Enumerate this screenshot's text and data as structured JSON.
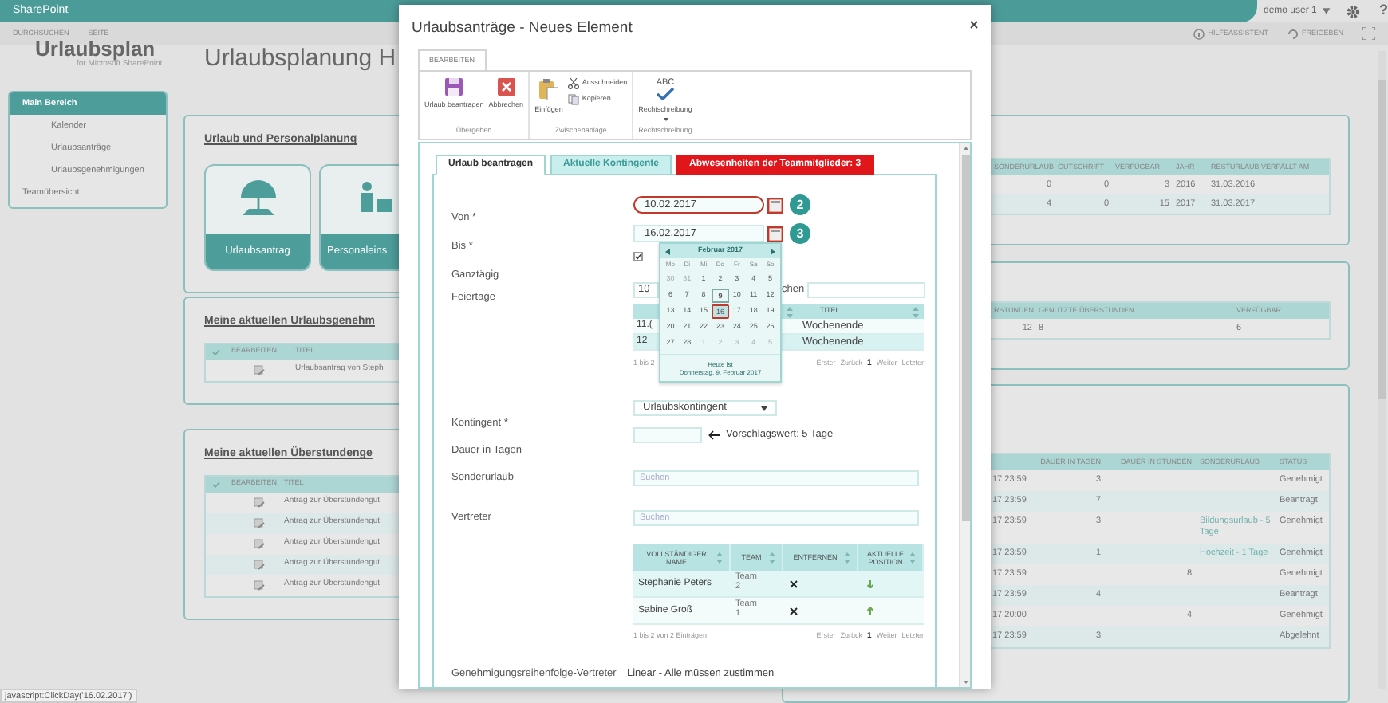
{
  "top_bar": {
    "brand": "SharePoint",
    "user": "demo user 1",
    "help": "?"
  },
  "command_bar": {
    "left": [
      "DURCHSUCHEN",
      "SEITE"
    ],
    "right": [
      "HILFEASSISTENT",
      "FREIGEBEN"
    ]
  },
  "logo": {
    "name": "Urlaubsplan",
    "subtitle": "for Microsoft SharePoint"
  },
  "page_title": "Urlaubsplanung H",
  "nav": [
    {
      "label": "Main Bereich",
      "selected": true,
      "children": [
        {
          "label": "Kalender",
          "selected": false
        },
        {
          "label": "Urlaubsanträge",
          "selected": false
        },
        {
          "label": "Urlaubsgenehmigungen",
          "selected": false
        }
      ]
    },
    {
      "label": "Teamübersicht",
      "selected": false
    }
  ],
  "cards_left": [
    {
      "kind": "tiles",
      "title": "Urlaub und Personalplanung",
      "tiles": [
        "Urlaubsantrag",
        "Personaleins"
      ]
    },
    {
      "kind": "list",
      "title": "Meine aktuellen Urlaubsgenehm",
      "columns": [
        "BEARBEITEN",
        "TITEL"
      ],
      "rows": [
        "Urlaubsantrag von Steph"
      ]
    },
    {
      "kind": "list",
      "title": "Meine aktuellen Überstundenge",
      "columns": [
        "BEARBEITEN",
        "TITEL"
      ],
      "rows": [
        "Antrag zur Überstundengut",
        "Antrag zur Überstundengut",
        "Antrag zur Überstundengut",
        "Antrag zur Überstundengut",
        "Antrag zur Überstundengut"
      ]
    }
  ],
  "contingent_table": {
    "columns": [
      "SONDERURLAUB",
      "GUTSCHRIFT",
      "VERFÜGBAR",
      "JAHR",
      "RESTURLAUB VERFÄLLT AM"
    ],
    "rows": [
      [
        "0",
        "0",
        "3",
        "2016",
        "31.03.2016"
      ],
      [
        "4",
        "0",
        "15",
        "2017",
        "31.03.2017"
      ]
    ]
  },
  "overtime_table": {
    "columns": [
      "RSTUNDEN",
      "GENUTZTE ÜBERSTUNDEN",
      "VERFÜGBAR"
    ],
    "rows": [
      [
        "12",
        "8",
        "6"
      ]
    ]
  },
  "requests_table": {
    "columns": [
      "DAUER IN TAGEN",
      "DAUER IN STUNDEN",
      "SONDERURLAUB",
      "STATUS"
    ],
    "rows": [
      {
        "column_1": "17 23:59",
        "days": "3",
        "status": "Genehmigt"
      },
      {
        "column_1": "17 23:59",
        "days": "7",
        "status": "Beantragt"
      },
      {
        "column_1": "17 23:59",
        "days": "3",
        "special": "Bildungsurlaub - 5 Tage",
        "status": "Genehmigt"
      },
      {
        "column_1": "17 23:59",
        "days": "1",
        "special": "Hochzeit - 1 Tage",
        "status": "Genehmigt"
      },
      {
        "column_1": "17 23:59",
        "hours": "8",
        "status": "Genehmigt"
      },
      {
        "column_1": "17 23:59",
        "days": "4",
        "status": "Beantragt"
      },
      {
        "column_1": "17 20:00",
        "hours": "4",
        "status": "Genehmigt"
      },
      {
        "column_1": "17 23:59",
        "days": "3",
        "status": "Abgelehnt"
      }
    ]
  },
  "dialog": {
    "title": "Urlaubsanträge - Neues Element",
    "ribbon_tab": {
      "label": "BEARBEITEN",
      "selected": true
    },
    "ribbon_groups": [
      {
        "label": "Übergeben",
        "buttons": [
          {
            "kind": "save",
            "label": "Urlaub beantragen"
          },
          {
            "kind": "cancel",
            "label": "Abbrechen"
          }
        ]
      },
      {
        "label": "Zwischenablage",
        "buttons": [
          {
            "kind": "paste",
            "label": "Einfügen"
          },
          {
            "kind": "cut",
            "label": "Ausschneiden"
          },
          {
            "kind": "copy",
            "label": "Kopieren"
          }
        ]
      },
      {
        "label": "Rechtschreibung",
        "buttons": [
          {
            "kind": "spelling",
            "label": "Rechtschreibung",
            "icon_text": "ABC"
          }
        ]
      }
    ],
    "tabs": [
      {
        "label": "Urlaub beantragen",
        "selected": true,
        "kind": "normal"
      },
      {
        "label": "Aktuelle Kontingente",
        "selected": false,
        "kind": "normal"
      },
      {
        "label": "Abwesenheiten der Teammitglieder: 3",
        "selected": false,
        "kind": "alert"
      }
    ],
    "von": {
      "label": "Von *",
      "value": "10.02.2017",
      "highlighted": true,
      "callout": "2"
    },
    "bis": {
      "label": "Bis *",
      "value": "16.02.2017",
      "highlighted": false,
      "callout": "3"
    },
    "ganztaegig": {
      "label": "Ganztägig",
      "checked": true
    },
    "feiertage": {
      "label": "Feiertage",
      "page_size": "10",
      "search_label": "chen",
      "columns": [
        "TITEL"
      ],
      "rows": [
        {
          "column_1": "11.(",
          "title": "Wochenende"
        },
        {
          "column_1": "12",
          "title": "Wochenende"
        }
      ],
      "info": "1 bis 2",
      "pager": [
        {
          "label": "Erster",
          "selected": false
        },
        {
          "label": "Zurück",
          "selected": false
        },
        {
          "label": "1",
          "selected": true
        },
        {
          "label": "Weiter",
          "selected": false
        },
        {
          "label": "Letzter",
          "selected": false
        }
      ]
    },
    "calendar": {
      "month": "Februar 2017",
      "weekdays": [
        "Mo",
        "Di",
        "Mi",
        "Do",
        "Fr",
        "Sa",
        "So"
      ],
      "weeks": [
        [
          {
            "day": "30",
            "outside": true,
            "today": false,
            "selected": false
          },
          {
            "day": "31",
            "outside": true,
            "today": false,
            "selected": false
          },
          {
            "day": "1",
            "outside": false,
            "today": false,
            "selected": false
          },
          {
            "day": "2",
            "outside": false,
            "today": false,
            "selected": false
          },
          {
            "day": "3",
            "outside": false,
            "today": false,
            "selected": false
          },
          {
            "day": "4",
            "outside": false,
            "today": false,
            "selected": false
          },
          {
            "day": "5",
            "outside": false,
            "today": false,
            "selected": false
          }
        ],
        [
          {
            "day": "6",
            "outside": false,
            "today": false,
            "selected": false
          },
          {
            "day": "7",
            "outside": false,
            "today": false,
            "selected": false
          },
          {
            "day": "8",
            "outside": false,
            "today": false,
            "selected": false
          },
          {
            "day": "9",
            "outside": false,
            "today": true,
            "selected": false
          },
          {
            "day": "10",
            "outside": false,
            "today": false,
            "selected": false
          },
          {
            "day": "11",
            "outside": false,
            "today": false,
            "selected": false
          },
          {
            "day": "12",
            "outside": false,
            "today": false,
            "selected": false
          }
        ],
        [
          {
            "day": "13",
            "outside": false,
            "today": false,
            "selected": false
          },
          {
            "day": "14",
            "outside": false,
            "today": false,
            "selected": false
          },
          {
            "day": "15",
            "outside": false,
            "today": false,
            "selected": false
          },
          {
            "day": "16",
            "outside": false,
            "today": false,
            "selected": true
          },
          {
            "day": "17",
            "outside": false,
            "today": false,
            "selected": false
          },
          {
            "day": "18",
            "outside": false,
            "today": false,
            "selected": false
          },
          {
            "day": "19",
            "outside": false,
            "today": false,
            "selected": false
          }
        ],
        [
          {
            "day": "20",
            "outside": false,
            "today": false,
            "selected": false
          },
          {
            "day": "21",
            "outside": false,
            "today": false,
            "selected": false
          },
          {
            "day": "22",
            "outside": false,
            "today": false,
            "selected": false
          },
          {
            "day": "23",
            "outside": false,
            "today": false,
            "selected": false
          },
          {
            "day": "24",
            "outside": false,
            "today": false,
            "selected": false
          },
          {
            "day": "25",
            "outside": false,
            "today": false,
            "selected": false
          },
          {
            "day": "26",
            "outside": false,
            "today": false,
            "selected": false
          }
        ],
        [
          {
            "day": "27",
            "outside": false,
            "today": false,
            "selected": false
          },
          {
            "day": "28",
            "outside": false,
            "today": false,
            "selected": false
          },
          {
            "day": "1",
            "outside": true,
            "today": false,
            "selected": false
          },
          {
            "day": "2",
            "outside": true,
            "today": false,
            "selected": false
          },
          {
            "day": "3",
            "outside": true,
            "today": false,
            "selected": false
          },
          {
            "day": "4",
            "outside": true,
            "today": false,
            "selected": false
          },
          {
            "day": "5",
            "outside": true,
            "today": false,
            "selected": false
          }
        ]
      ],
      "footer": [
        "Heute ist",
        "Donnerstag, 9. Februar 2017"
      ]
    },
    "kontingent": {
      "label": "Kontingent *",
      "value": "Urlaubskontingent"
    },
    "dauer": {
      "label": "Dauer in Tagen",
      "hint": "Vorschlagswert: 5 Tage"
    },
    "sonderurlaub": {
      "label": "Sonderurlaub",
      "placeholder": "Suchen"
    },
    "vertreter": {
      "label": "Vertreter",
      "placeholder": "Suchen",
      "columns": [
        "VOLLSTÄNDIGER NAME",
        "TEAM",
        "ENTFERNEN",
        "AKTUELLE POSITION"
      ],
      "rows": [
        {
          "name": "Stephanie Peters",
          "team": "Team 2",
          "up": false
        },
        {
          "name": "Sabine Groß",
          "team": "Team 1",
          "up": true
        }
      ],
      "info": "1 bis 2 von 2 Einträgen",
      "pager": [
        {
          "label": "Erster",
          "selected": false
        },
        {
          "label": "Zurück",
          "selected": false
        },
        {
          "label": "1",
          "selected": true
        },
        {
          "label": "Weiter",
          "selected": false
        },
        {
          "label": "Letzter",
          "selected": false
        }
      ]
    },
    "genehmigung": {
      "label": "Genehmigungsreihenfolge-Vertreter",
      "value": "Linear - Alle müssen zustimmen"
    }
  },
  "status_bar": "javascript:ClickDay('16.02.2017')"
}
